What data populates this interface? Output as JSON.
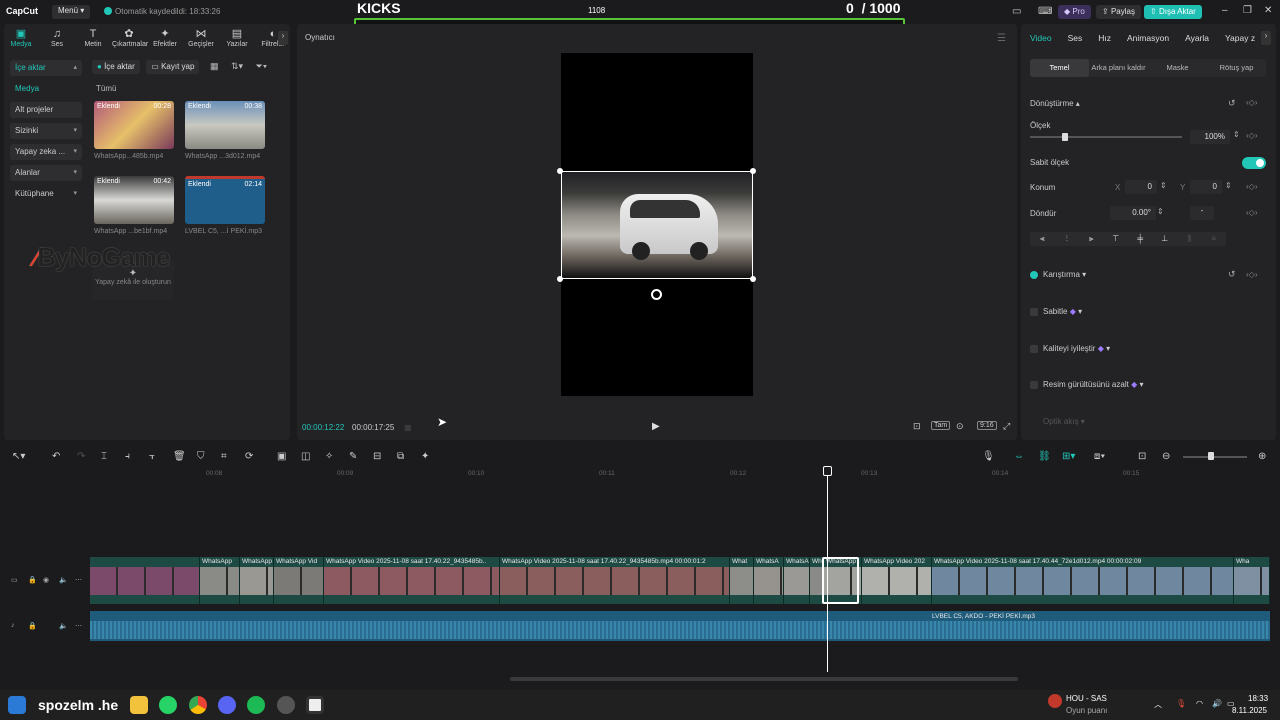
{
  "app": {
    "logo": "CapCut",
    "menu": "Menü",
    "autosave": "Otomatik kaydedildi: 18:33:26"
  },
  "overlay": {
    "title": "KICKS",
    "mid": "1108",
    "score": "0",
    "goal": "/ 1000",
    "progress": 0.0
  },
  "topbar": {
    "pro": "Pro",
    "share": "Paylaş",
    "export": "Dışa Aktar"
  },
  "left_tabs": [
    {
      "label": "Medya",
      "icon": "media-icon"
    },
    {
      "label": "Ses",
      "icon": "audio-icon"
    },
    {
      "label": "Metin",
      "icon": "text-icon"
    },
    {
      "label": "Çıkartmalar",
      "icon": "sticker-icon"
    },
    {
      "label": "Efektler",
      "icon": "effects-icon"
    },
    {
      "label": "Geçişler",
      "icon": "transition-icon"
    },
    {
      "label": "Yazılar",
      "icon": "captions-icon"
    },
    {
      "label": "Filtreler",
      "icon": "filter-icon"
    }
  ],
  "sidenav": [
    "İçe aktar",
    "Medya",
    "Alt projeler",
    "Sizinki",
    "Yapay zeka ...",
    "Alanlar",
    "Kütüphane"
  ],
  "media": {
    "import": "İçe aktar",
    "record": "Kayıt yap",
    "all": "Tümü",
    "items": [
      {
        "tag": "Eklendi",
        "duration": "00:28",
        "name": "WhatsApp...485b.mp4"
      },
      {
        "tag": "Eklendi",
        "duration": "00:38",
        "name": "WhatsApp ...3d012.mp4"
      },
      {
        "tag": "Eklendi",
        "duration": "00:42",
        "name": "WhatsApp ...be1bf.mp4"
      },
      {
        "tag": "Eklendi",
        "duration": "02:14",
        "name": "LVBEL C5, ...İ PEKİ.mp3"
      }
    ],
    "ai_create": "Yapay zekâ ile oluşturun"
  },
  "watermark": "ByNoGame",
  "player": {
    "title": "Oynatıcı",
    "current": "00:00:12:22",
    "total": "00:00:17:25",
    "full_label": "Tam",
    "ratio": "9:16"
  },
  "right": {
    "tabs": [
      "Video",
      "Ses",
      "Hız",
      "Animasyon",
      "Ayarla",
      "Yapay z"
    ],
    "subtabs": [
      "Temel",
      "Arka planı kaldır",
      "Maske",
      "Rötuş yap"
    ],
    "transform": "Dönüştürme",
    "scale_label": "Ölçek",
    "scale_value": "100%",
    "scale": 0.25,
    "uniform_scale": "Sabit ölçek",
    "position_label": "Konum",
    "x_label": "X",
    "x_value": "0",
    "y_label": "Y",
    "y_value": "0",
    "rotate_label": "Döndür",
    "rotate_value": "0.00°",
    "blend": "Karıştırma",
    "stabilize": "Sabitle",
    "enhance": "Kaliteyi iyileştir",
    "denoise": "Resim gürültüsünü azalt",
    "optical": "Optik akış"
  },
  "timeline": {
    "ruler": [
      "00:08",
      "00:09",
      "00:10",
      "00:11",
      "00:12",
      "00:13",
      "00:14",
      "00:15"
    ],
    "clips": [
      {
        "label": "",
        "color": "#7b4a6a"
      },
      {
        "label": "WhatsApp",
        "color": "#8a8a86"
      },
      {
        "label": "WhatsApp",
        "color": "#9a9893"
      },
      {
        "label": "WhatsApp Vid",
        "color": "#7c7a76"
      },
      {
        "label": "WhatsApp Video 2025-11-08 saat 17.40.22_9435485b..",
        "color": "#8c5a60"
      },
      {
        "label": "WhatsApp Video 2025-11-08 saat 17.40.22_9435485b.mp4  00:00:01:2",
        "color": "#8a5e5c"
      },
      {
        "label": "What",
        "color": "#8d8d8a"
      },
      {
        "label": "WhatsA",
        "color": "#96938f"
      },
      {
        "label": "WhatsA",
        "color": "#9b9995"
      },
      {
        "label": "What",
        "color": "#8a8a88"
      },
      {
        "label": "WhatsApp",
        "color": "#a3a3a0"
      },
      {
        "label": "WhatsApp Video 202",
        "color": "#b0b0ad"
      },
      {
        "label": "WhatsApp Video 2025-11-08 saat 17.40.44_72e1d012.mp4  00:00:02:09",
        "color": "#6f88a0"
      },
      {
        "label": "Wha",
        "color": "#7e90a2"
      }
    ],
    "audio": "LVBEL C5, AKDO - PEKİ PEKİ.mp3"
  },
  "taskbar": {
    "user": "spozelm .he",
    "game": "HOU - SAS",
    "game_sub": "Oyun puanı",
    "time": "18:33",
    "date": "8.11.2025"
  }
}
